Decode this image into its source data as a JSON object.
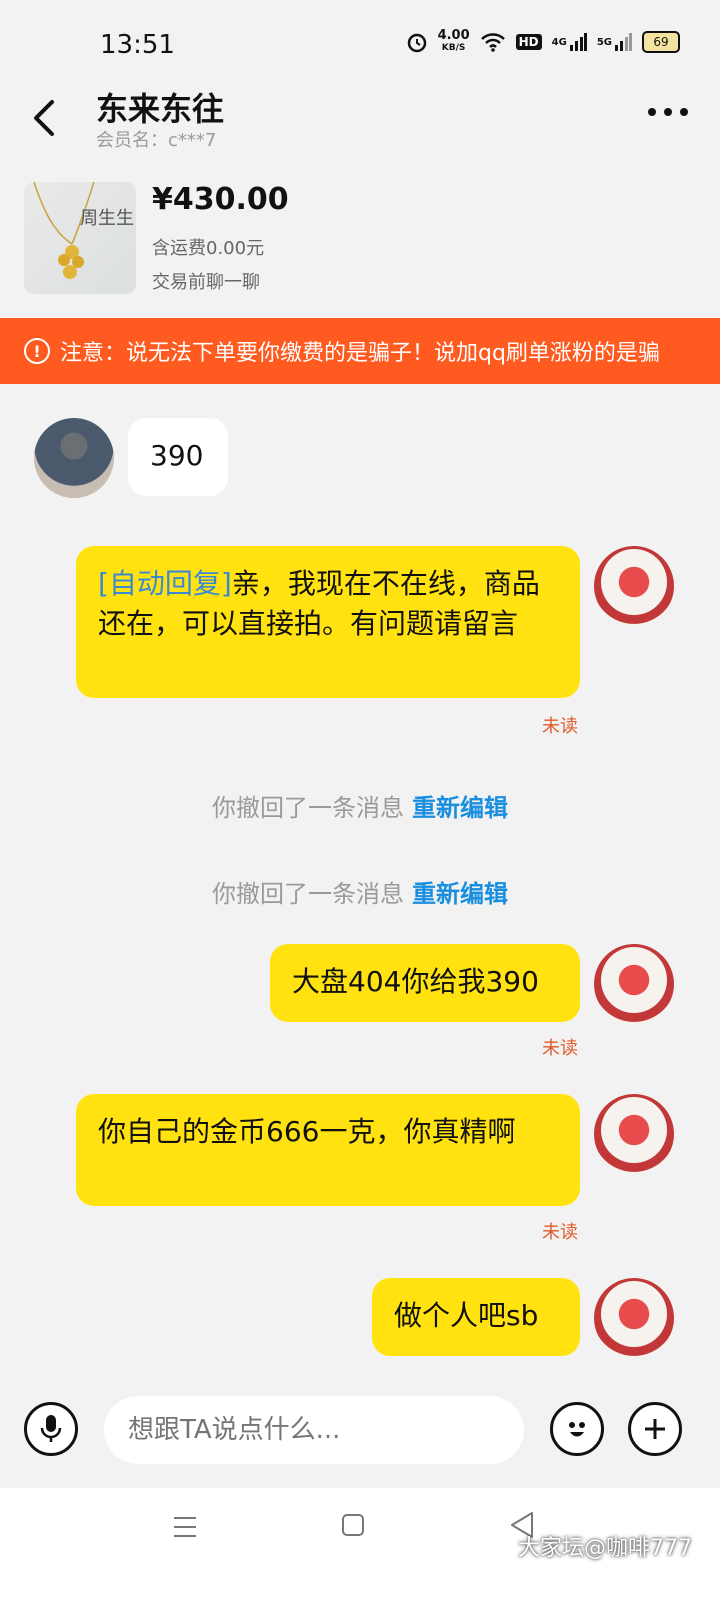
{
  "status": {
    "time": "13:51",
    "netspeed_value": "4.00",
    "netspeed_unit": "KB/S",
    "battery": "69",
    "hd": "HD",
    "sig1": "4G",
    "sig2": "5G"
  },
  "header": {
    "title": "东来东往",
    "subtitle": "会员名：c***7"
  },
  "product": {
    "price": "¥430.00",
    "fee": "含运费0.00元",
    "note": "交易前聊一聊",
    "thumb_text": "周生生"
  },
  "warning": {
    "text": "注意：说无法下单要你缴费的是骗子！说加qq刷单涨粉的是骗"
  },
  "messages": {
    "m1": "390",
    "m2_tag": "[自动回复]",
    "m2_text": "亲，我现在不在线，商品还在，可以直接拍。有问题请留言",
    "m3": "大盘404你给我390",
    "m4": "你自己的金币666一克，你真精啊",
    "m5": "做个人吧sb",
    "unread": "未读"
  },
  "system": {
    "recall": "你撤回了一条消息",
    "edit": "重新编辑"
  },
  "input": {
    "placeholder": "想跟TA说点什么..."
  },
  "watermark": "大家坛@咖啡777",
  "colors": {
    "accent": "#ffe20f",
    "warning_bg": "#ff5a1f",
    "link": "#1a8fe0"
  }
}
